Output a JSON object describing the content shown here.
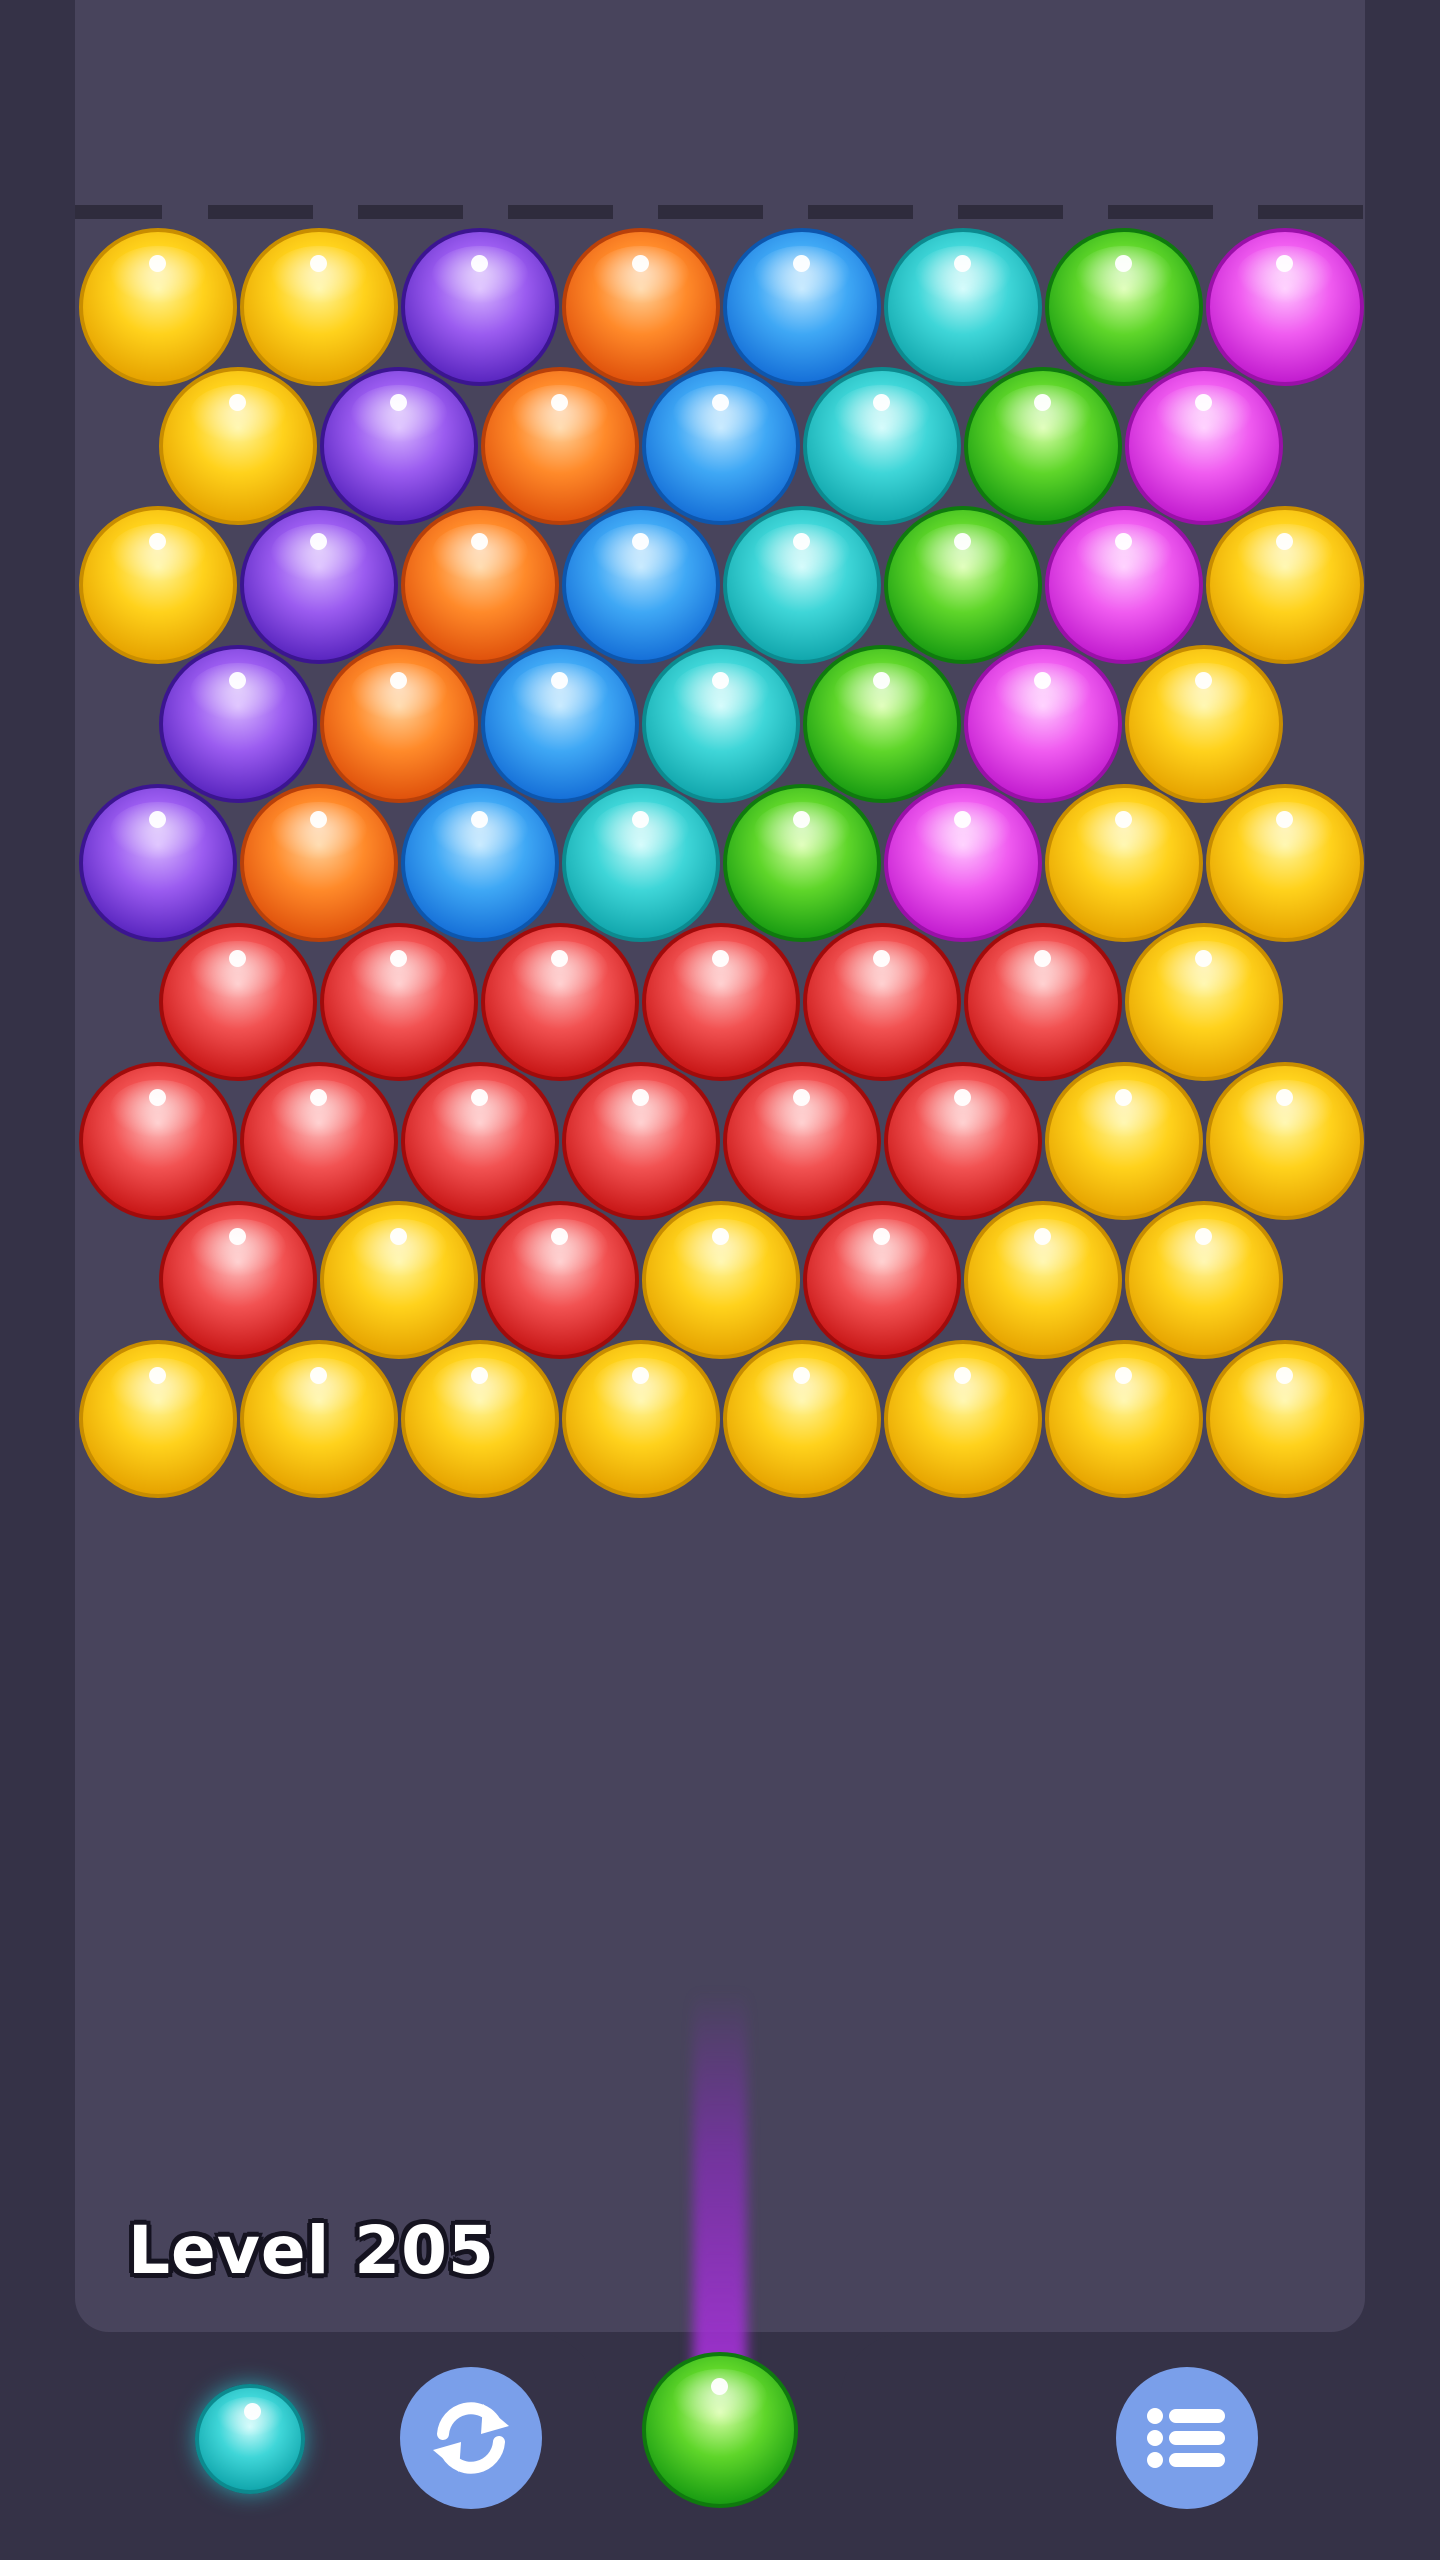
{
  "game": {
    "level_label": "Level 205"
  },
  "colors": {
    "yellow": [
      "#fff59a",
      "#ffd21c",
      "#e6a300",
      "#c88d00"
    ],
    "purple": [
      "#d6b4ff",
      "#9b5cf0",
      "#5a26c0",
      "#3b1590"
    ],
    "orange": [
      "#ffd29a",
      "#ff8a2a",
      "#e0520c",
      "#b8400a"
    ],
    "blue": [
      "#b8e4ff",
      "#3fa8f5",
      "#1670d8",
      "#0d56ad"
    ],
    "teal": [
      "#c9fbfb",
      "#3fd6d8",
      "#12a7ad",
      "#0c8a8f"
    ],
    "green": [
      "#d8ffa8",
      "#5fd62a",
      "#199c12",
      "#0f7a0e"
    ],
    "pink": [
      "#ffc4ff",
      "#f05cf0",
      "#c21ccf",
      "#9a10a8"
    ],
    "red": [
      "#ffc2c2",
      "#f25252",
      "#c81616",
      "#a00b0b"
    ]
  },
  "bubble_rows": [
    [
      "yellow",
      "yellow",
      "purple",
      "orange",
      "blue",
      "teal",
      "green",
      "pink"
    ],
    [
      "yellow",
      "purple",
      "orange",
      "blue",
      "teal",
      "green",
      "pink"
    ],
    [
      "yellow",
      "purple",
      "orange",
      "blue",
      "teal",
      "green",
      "pink",
      "yellow"
    ],
    [
      "purple",
      "orange",
      "blue",
      "teal",
      "green",
      "pink",
      "yellow"
    ],
    [
      "purple",
      "orange",
      "blue",
      "teal",
      "green",
      "pink",
      "yellow",
      "yellow"
    ],
    [
      "red",
      "red",
      "red",
      "red",
      "red",
      "red",
      "yellow"
    ],
    [
      "red",
      "red",
      "red",
      "red",
      "red",
      "red",
      "yellow",
      "yellow"
    ],
    [
      "red",
      "yellow",
      "red",
      "yellow",
      "red",
      "yellow",
      "yellow"
    ],
    [
      "yellow",
      "yellow",
      "yellow",
      "yellow",
      "yellow",
      "yellow",
      "yellow",
      "yellow"
    ]
  ],
  "shooter": {
    "current_color": "green",
    "next_color": "teal",
    "aim_beam_color": "#9a2fd4"
  },
  "icons": {
    "swap": "refresh-arrows-icon",
    "menu": "list-icon"
  }
}
